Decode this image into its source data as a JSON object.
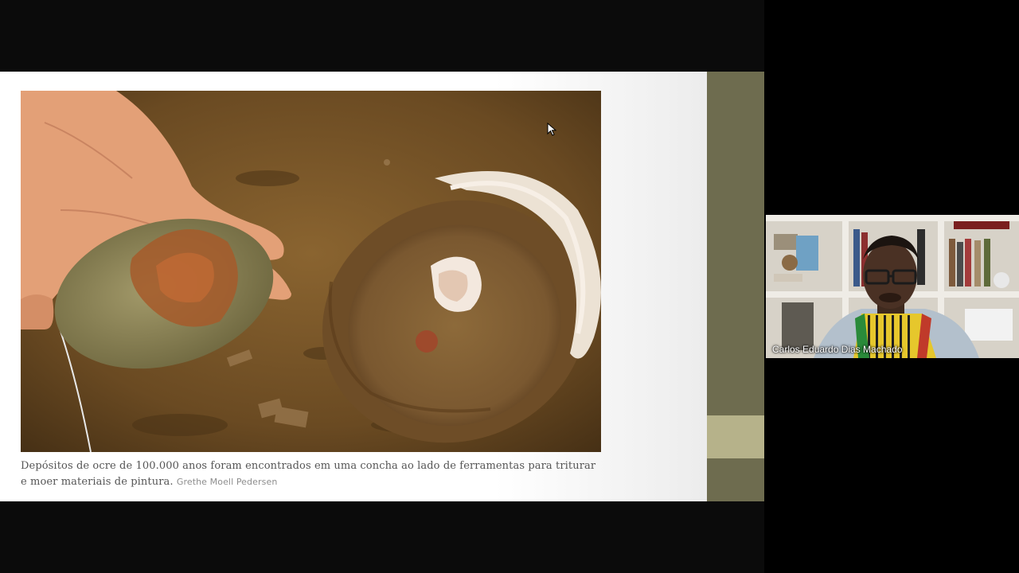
{
  "slide": {
    "caption_text": "Depósitos de ocre de 100.000 anos foram encontrados em uma concha ao lado de ferramentas para triturar e moer materiais de pintura.",
    "caption_credit": "Grethe Moell Pedersen"
  },
  "photo": {
    "subject": "hand holding ochre-stained grinding stone beside abalone shell with ochre deposit in sand"
  },
  "participant": {
    "name": "Carlos Eduardo Dias Machado"
  },
  "colors": {
    "side_strip": "#6e6c4f",
    "side_strip_band": "#b6b28a",
    "background": "#000000"
  }
}
